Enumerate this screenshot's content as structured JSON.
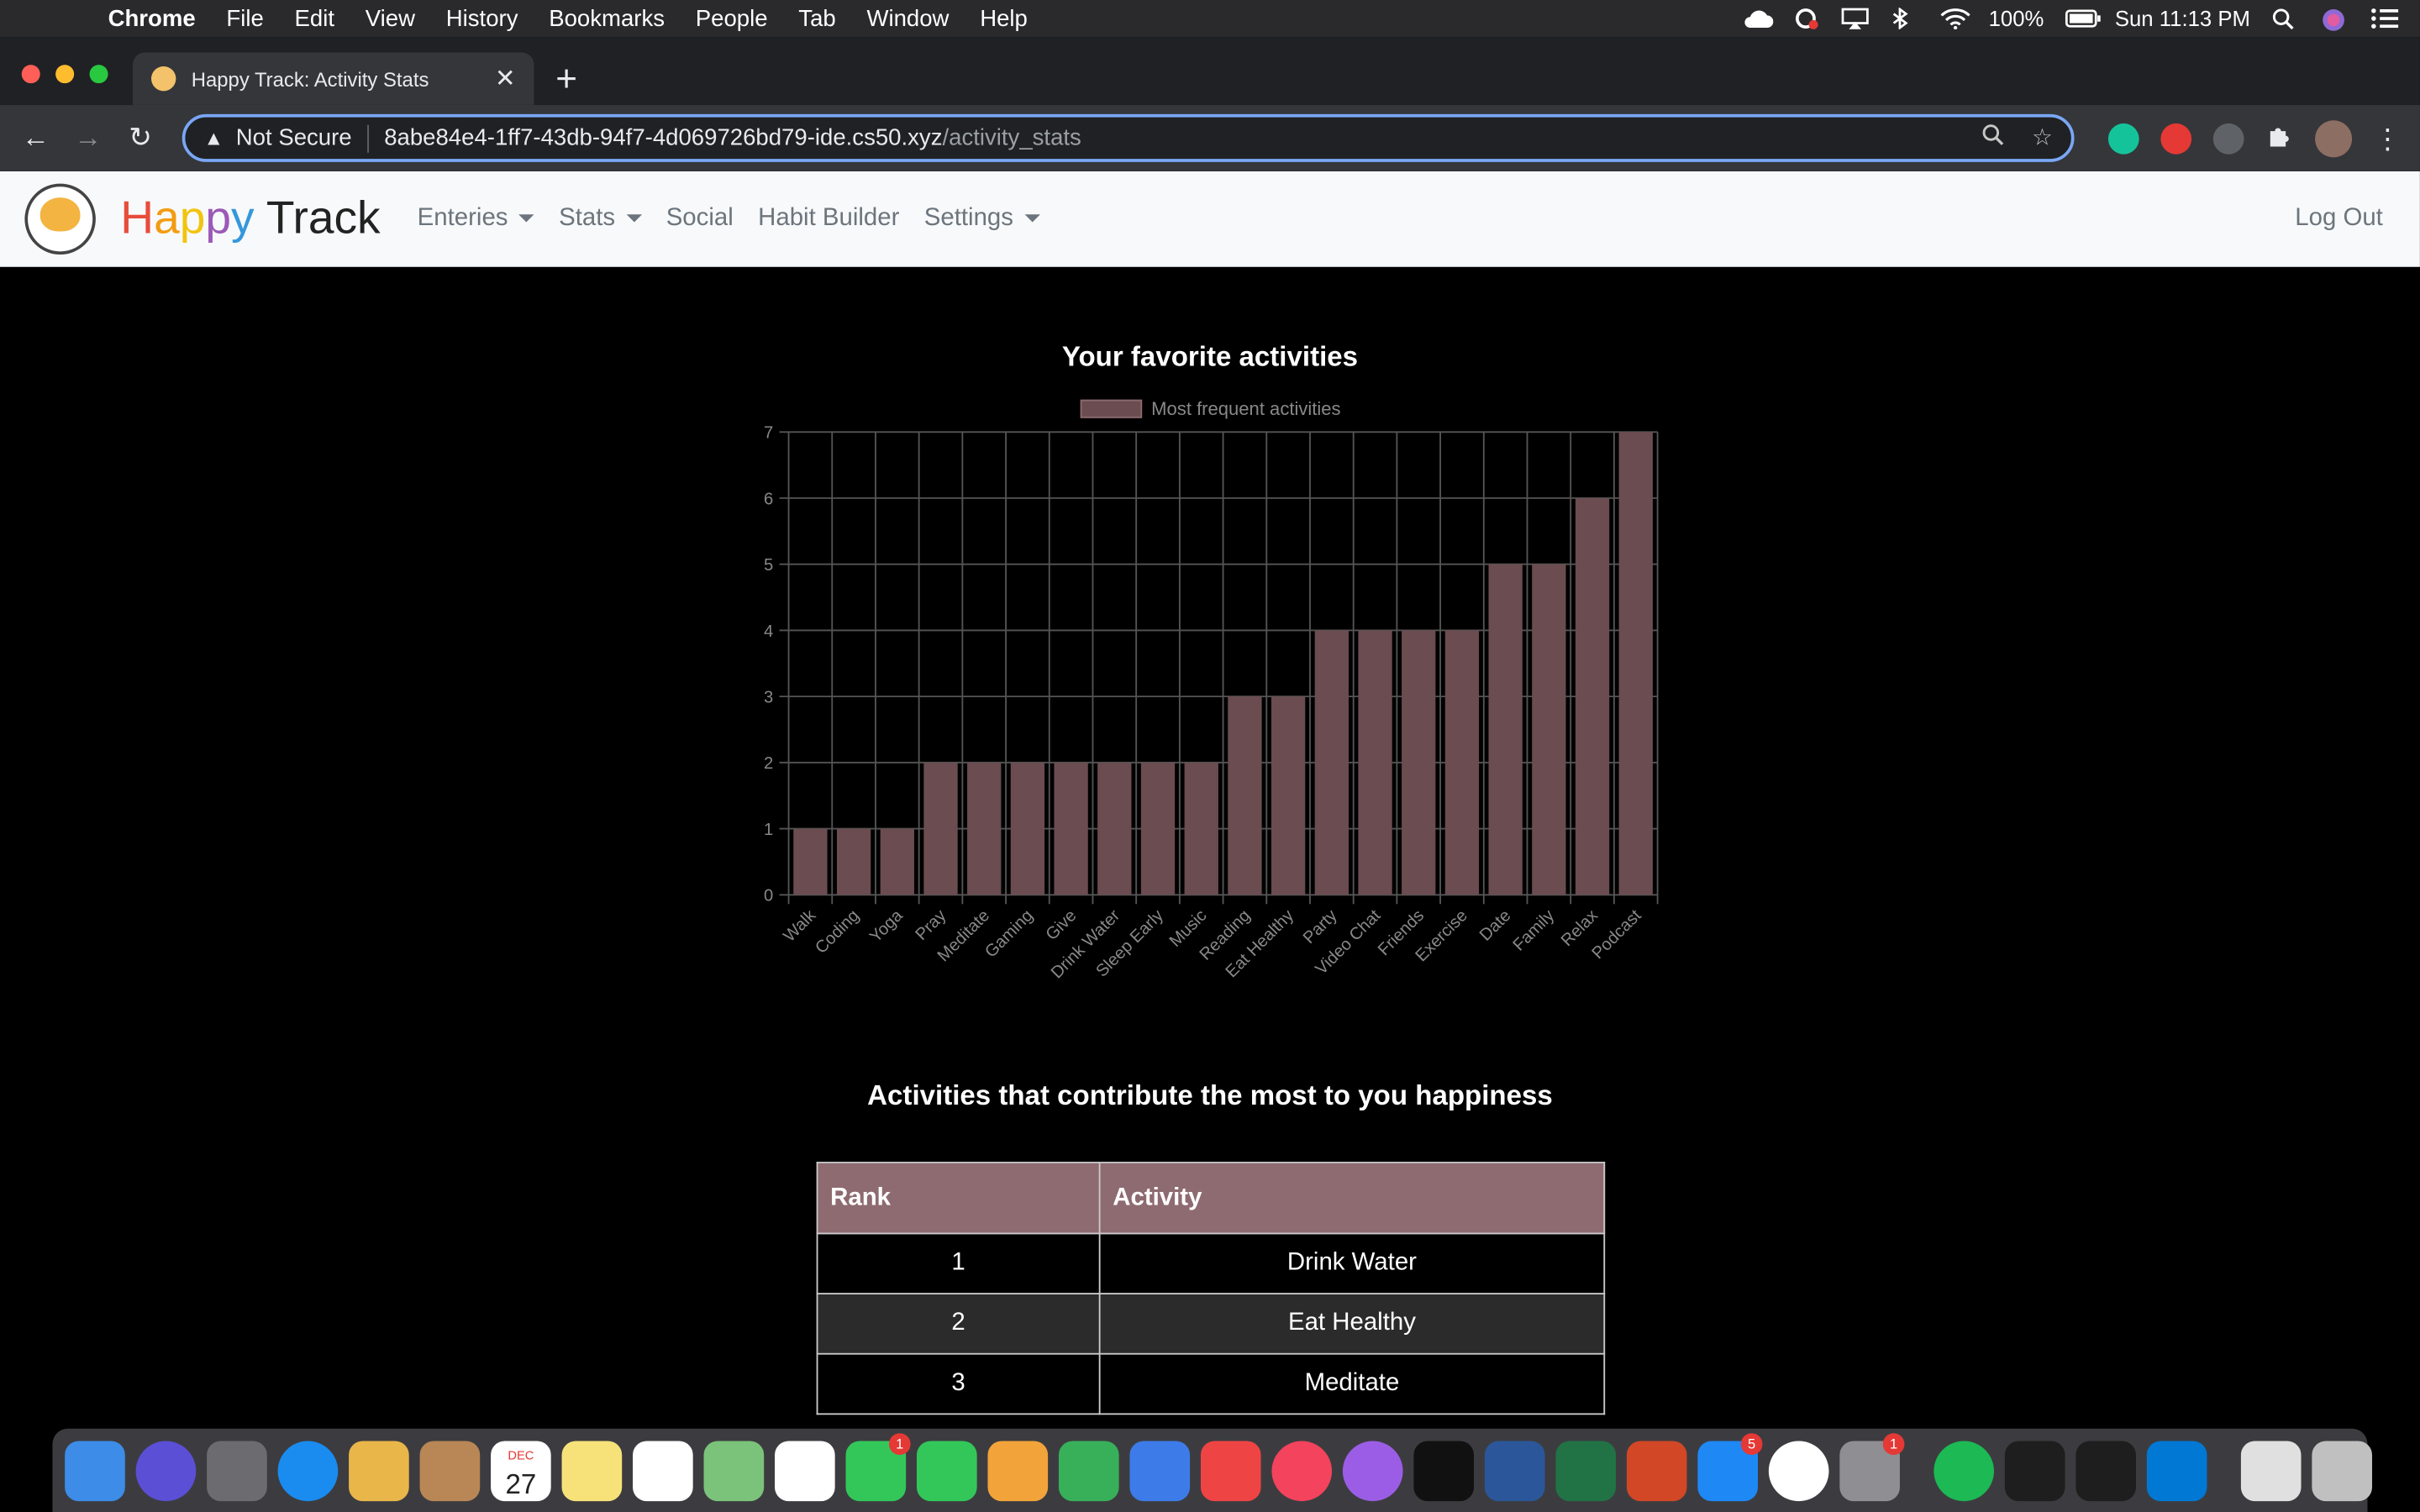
{
  "menubar": {
    "app": "Chrome",
    "items": [
      "File",
      "Edit",
      "View",
      "History",
      "Bookmarks",
      "People",
      "Tab",
      "Window",
      "Help"
    ],
    "battery": "100%",
    "clock": "Sun 11:13 PM"
  },
  "browser": {
    "tab_title": "Happy Track: Activity Stats",
    "security_label": "Not Secure",
    "url_host": "8abe84e4-1ff7-43db-94f7-4d069726bd79-ide.cs50.xyz",
    "url_path": "/activity_stats"
  },
  "navbar": {
    "brand_happy": [
      "H",
      "a",
      "p",
      "p",
      "y"
    ],
    "brand_track": "Track",
    "links": [
      "Enteries",
      "Stats",
      "Social",
      "Habit Builder",
      "Settings"
    ],
    "logout": "Log Out"
  },
  "chart_data": {
    "type": "bar",
    "title": "Your favorite activities",
    "legend": "Most frequent activities",
    "categories": [
      "Walk",
      "Coding",
      "Yoga",
      "Pray",
      "Meditate",
      "Gaming",
      "Give",
      "Drink Water",
      "Sleep Early",
      "Music",
      "Reading",
      "Eat Healthy",
      "Party",
      "Video Chat",
      "Friends",
      "Exercise",
      "Date",
      "Family",
      "Relax",
      "Podcast"
    ],
    "values": [
      1,
      1,
      1,
      2,
      2,
      2,
      2,
      2,
      2,
      2,
      3,
      3,
      4,
      4,
      4,
      4,
      5,
      5,
      6,
      7
    ],
    "ylim": [
      0,
      7
    ],
    "yticks": [
      "0",
      "1",
      "2",
      "3",
      "4",
      "5",
      "6",
      "7"
    ],
    "bar_color": "#6a4c51",
    "grid": true
  },
  "ranking": {
    "title": "Activities that contribute the most to you happiness",
    "headers": [
      "Rank",
      "Activity"
    ],
    "rows": [
      {
        "rank": "1",
        "activity": "Drink Water"
      },
      {
        "rank": "2",
        "activity": "Eat Healthy"
      },
      {
        "rank": "3",
        "activity": "Meditate"
      }
    ]
  },
  "dock": {
    "icons": [
      "finder-icon",
      "siri-icon",
      "launchpad-icon",
      "safari-icon",
      "mail-icon",
      "contacts-icon",
      "calendar-icon",
      "notes-icon",
      "reminders-icon",
      "maps-icon",
      "photos-icon",
      "messages-icon",
      "facetime-icon",
      "pages-icon",
      "numbers-icon",
      "keynote-icon",
      "news-icon",
      "music-icon",
      "podcasts-icon",
      "tv-icon",
      "word-icon",
      "excel-icon",
      "powerpoint-icon",
      "app-store-icon",
      "chrome-icon",
      "system-preferences-icon",
      "spotify-icon",
      "terminal-icon",
      "acrobat-icon",
      "vscode-icon",
      "archive-icon",
      "trash-icon"
    ],
    "calendar_month": "DEC",
    "calendar_day": "27",
    "messages_badge": "1",
    "app_store_badge": "5",
    "system_prefs_badge": "1"
  }
}
